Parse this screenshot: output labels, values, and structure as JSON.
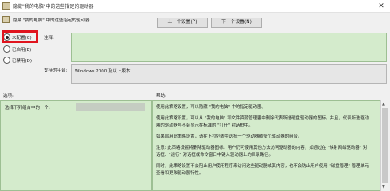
{
  "window": {
    "title": "隐藏\"我的电脑\"中的这些指定的驱动器"
  },
  "policy": {
    "name": "隐藏 \"我的电脑\" 中的这些指定的驱动器"
  },
  "nav": {
    "prev_label": "上一个设置(P)",
    "next_label": "下一个设置(N)"
  },
  "state_options": [
    {
      "label": "未配置(C)",
      "selected": true
    },
    {
      "label": "已启用(E)",
      "selected": false
    },
    {
      "label": "已禁用(D)",
      "selected": false
    }
  ],
  "comment": {
    "label": "注释:",
    "value": ""
  },
  "supported": {
    "label": "支持的平台:",
    "value": "Windows 2000 及以上版本"
  },
  "options": {
    "header": "选项:",
    "item_text": "选择下列组合中的一个:",
    "item_value": ""
  },
  "help": {
    "header": "帮助:",
    "paragraphs": [
      "使用此策略设置，可以隐藏 \"我的电脑\" 中的指定驱动器。",
      "使用此策略设置，可以从 \"我的电脑\" 和文件资源管理器中删除代表所选硬盘驱动器的图标。并且，代表所选驱动器的驱动器号不会显示在标准的 \"打开\" 对话框中。",
      "如果启用此策略设置，请在下拉列表中选择一个驱动器或多个驱动器的组合。",
      "注意: 此策略设置将删除驱动器图标。用户仍可使用其他方法访问驱动器的内容，如通过在 \"映射网络驱动器\" 对话框、\"运行\" 对话框或命令窗口中键入驱动器上的目录路径。",
      "同时，此策略设置不会阻止用户使用程序来访问这些驱动器或其内容，也不会防止用户使用 \"磁盘管理\" 管理单元查看和更改驱动器特性。"
    ]
  }
}
